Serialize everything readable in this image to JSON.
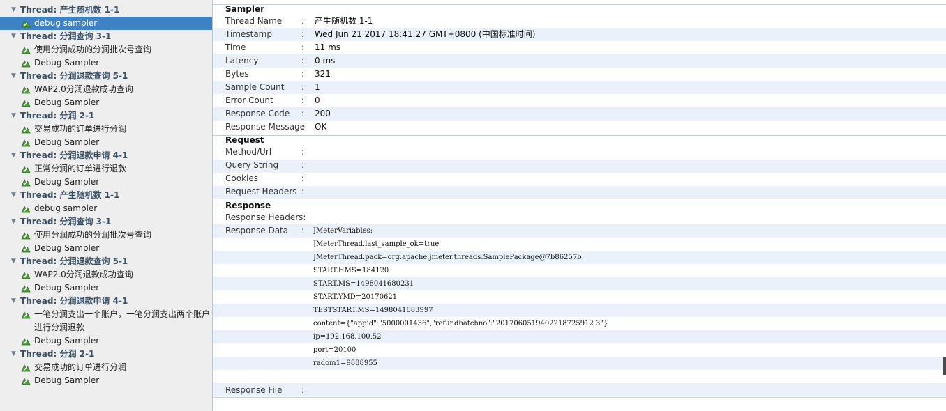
{
  "tree": {
    "nodes": [
      {
        "kind": "thread",
        "label": "Thread: 产生随机数 1-1"
      },
      {
        "kind": "sampler",
        "label": "debug sampler",
        "selected": true
      },
      {
        "kind": "thread",
        "label": "Thread: 分润查询 3-1"
      },
      {
        "kind": "sampler",
        "label": "使用分润成功的分润批次号查询"
      },
      {
        "kind": "sampler",
        "label": "Debug Sampler"
      },
      {
        "kind": "thread",
        "label": "Thread: 分润退款查询 5-1"
      },
      {
        "kind": "sampler",
        "label": "WAP2.0分润退款成功查询"
      },
      {
        "kind": "sampler",
        "label": "Debug Sampler"
      },
      {
        "kind": "thread",
        "label": "Thread: 分润 2-1"
      },
      {
        "kind": "sampler",
        "label": "交易成功的订单进行分润"
      },
      {
        "kind": "sampler",
        "label": "Debug Sampler"
      },
      {
        "kind": "thread",
        "label": "Thread: 分润退款申请 4-1"
      },
      {
        "kind": "sampler",
        "label": "正常分润的订单进行退款"
      },
      {
        "kind": "sampler",
        "label": "Debug Sampler"
      },
      {
        "kind": "thread",
        "label": "Thread: 产生随机数 1-1"
      },
      {
        "kind": "sampler",
        "label": "debug sampler"
      },
      {
        "kind": "thread",
        "label": "Thread: 分润查询 3-1"
      },
      {
        "kind": "sampler",
        "label": "使用分润成功的分润批次号查询"
      },
      {
        "kind": "sampler",
        "label": "Debug Sampler"
      },
      {
        "kind": "thread",
        "label": "Thread: 分润退款查询 5-1"
      },
      {
        "kind": "sampler",
        "label": "WAP2.0分润退款成功查询"
      },
      {
        "kind": "sampler",
        "label": "Debug Sampler"
      },
      {
        "kind": "thread",
        "label": "Thread: 分润退款申请 4-1"
      },
      {
        "kind": "sampler",
        "label": "一笔分润支出一个账户，一笔分润支出两个账户"
      },
      {
        "kind": "cont",
        "label": "进行分润退款"
      },
      {
        "kind": "sampler",
        "label": "Debug Sampler"
      },
      {
        "kind": "thread",
        "label": "Thread: 分润 2-1"
      },
      {
        "kind": "sampler",
        "label": "交易成功的订单进行分润"
      },
      {
        "kind": "sampler",
        "label": "Debug Sampler"
      }
    ]
  },
  "sampler": {
    "title": "Sampler",
    "rows": [
      {
        "label": "Thread Name",
        "value": "产生随机数 1-1"
      },
      {
        "label": "Timestamp",
        "value": "Wed Jun 21 2017 18:41:27 GMT+0800 (中国标准时间)"
      },
      {
        "label": "Time",
        "value": "11 ms"
      },
      {
        "label": "Latency",
        "value": "0 ms"
      },
      {
        "label": "Bytes",
        "value": "321"
      },
      {
        "label": "Sample Count",
        "value": "1"
      },
      {
        "label": "Error Count",
        "value": "0"
      },
      {
        "label": "Response Code",
        "value": "200"
      },
      {
        "label": "Response Message",
        "value": "OK"
      }
    ]
  },
  "request": {
    "title": "Request",
    "rows": [
      {
        "label": "Method/Url",
        "value": ""
      },
      {
        "label": "Query String",
        "value": ""
      },
      {
        "label": "Cookies",
        "value": ""
      },
      {
        "label": "Request Headers",
        "value": ""
      }
    ]
  },
  "response": {
    "title": "Response",
    "headers_label": "Response Headers:",
    "data_label": "Response Data",
    "data_lines": [
      "JMeterVariables:",
      "JMeterThread.last_sample_ok=true",
      "JMeterThread.pack=org.apache.jmeter.threads.SamplePackage@7b86257b",
      "START.HMS=184120",
      "START.MS=1498041680231",
      "START.YMD=20170621",
      "TESTSTART.MS=1498041683997",
      "content={\"appid\":\"5000001436\",\"refundbatchno\":\"2017060519402218725912 3\"}",
      "ip=192.168.100.52",
      "port=20100",
      "radom1=9888955"
    ],
    "file_label": "Response File"
  },
  "separator": ":",
  "icons": {
    "sampler": "sampler-icon",
    "expand": "expand-triangle-icon"
  }
}
